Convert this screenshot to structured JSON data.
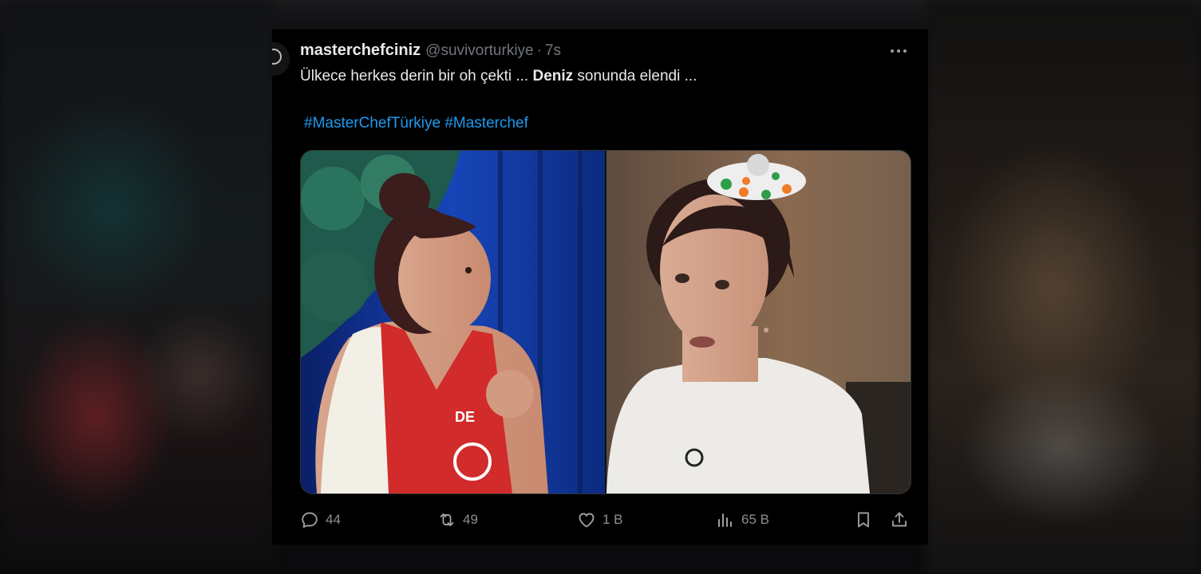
{
  "tweet": {
    "display_name": "masterchefciniz",
    "handle": "@suvivorturkiye",
    "separator": "·",
    "time": "7s",
    "text_part1": "Ülkece herkes derin bir oh çekti ... ",
    "text_bold": "Deniz",
    "text_part2": " sonunda elendi ...",
    "hashtags": [
      "#MasterChefTürkiye",
      "#Masterchef"
    ],
    "media_alt": "Two photos of a contestant",
    "apron_text": "DE"
  },
  "actions": {
    "replies": "44",
    "reposts": "49",
    "likes": "1 B",
    "views": "65 B"
  },
  "colors": {
    "link": "#1d9bf0",
    "muted": "#71767b",
    "background": "#000000"
  },
  "icons": [
    "more-icon",
    "reply-icon",
    "repost-icon",
    "like-icon",
    "views-icon",
    "bookmark-icon",
    "share-icon"
  ]
}
